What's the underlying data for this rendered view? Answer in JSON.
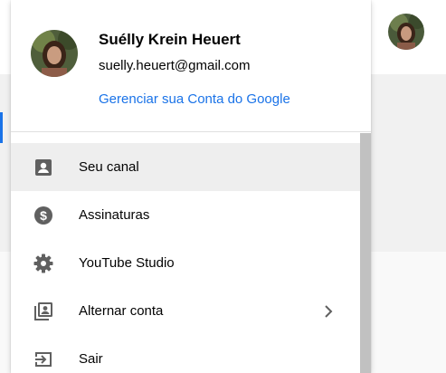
{
  "account": {
    "name": "Suélly Krein Heuert",
    "email": "suelly.heuert@gmail.com",
    "manage_label": "Gerenciar sua Conta do Google"
  },
  "menu": {
    "items": [
      {
        "label": "Seu canal",
        "icon": "account-box-icon",
        "active": true
      },
      {
        "label": "Assinaturas",
        "icon": "dollar-circle-icon",
        "active": false
      },
      {
        "label": "YouTube Studio",
        "icon": "gear-icon",
        "active": false
      },
      {
        "label": "Alternar conta",
        "icon": "switch-account-icon",
        "active": false,
        "has_submenu": true
      },
      {
        "label": "Sair",
        "icon": "sign-out-icon",
        "active": false
      }
    ]
  },
  "colors": {
    "link": "#1a73e8",
    "text": "#030303",
    "icon": "#606060",
    "active_row": "#eeeeee"
  }
}
